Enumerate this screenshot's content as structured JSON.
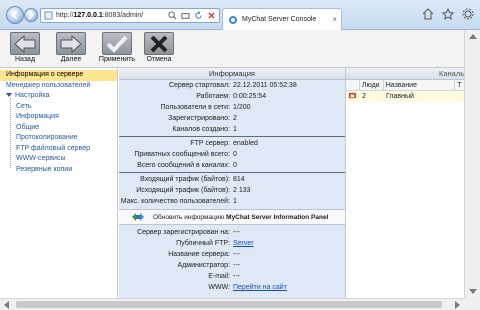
{
  "browser": {
    "address_prefix": "http://",
    "address_host": "127.0.0.1",
    "address_rest": ":8083/admin/",
    "tab_title": "MyChat Server Console",
    "tab_close": "×"
  },
  "toolbar": {
    "back": "Назад",
    "forward": "Далее",
    "apply": "Применить",
    "cancel": "Отмена"
  },
  "sidebar": {
    "items": [
      {
        "label": "Информация о сервере"
      },
      {
        "label": "Менеджер пользователей"
      },
      {
        "label": "Настройка"
      },
      {
        "label": "Сеть"
      },
      {
        "label": "Информация"
      },
      {
        "label": "Общие"
      },
      {
        "label": "Протоколирование"
      },
      {
        "label": "FTP файловый сервер"
      },
      {
        "label": "WWW-сервисы"
      },
      {
        "label": "Резервные копии"
      }
    ]
  },
  "info": {
    "header": "Информация",
    "rows_a": [
      {
        "k": "Сервер стартовал:",
        "v": "22.12.2011 05:52:38"
      },
      {
        "k": "Работаем:",
        "v": "0:00:25:54"
      },
      {
        "k": "Пользователи в сети:",
        "v": "1/200"
      },
      {
        "k": "Зарегистрировано:",
        "v": "2"
      },
      {
        "k": "Каналов создано:",
        "v": "1"
      }
    ],
    "rows_b": [
      {
        "k": "FTP сервер:",
        "v": "enabled"
      },
      {
        "k": "Приватных сообщений всего:",
        "v": "0"
      },
      {
        "k": "Всего сообщений в каналах:",
        "v": "0"
      }
    ],
    "rows_c": [
      {
        "k": "Входящий трафик (байтов):",
        "v": "814"
      },
      {
        "k": "Исходящий трафик (байтов):",
        "v": "2 133"
      },
      {
        "k": "Макс. количество пользователей:",
        "v": "1"
      }
    ],
    "update_prefix": "Обновить информацию ",
    "update_bold": "MyChat Server Information Panel",
    "rows_d": [
      {
        "k": "Сервер зарегистрирован на:",
        "v": "---"
      },
      {
        "k": "Публичный FTP:",
        "v": "Server"
      },
      {
        "k": "Название сервера:",
        "v": "---"
      },
      {
        "k": "Администратор:",
        "v": "---"
      },
      {
        "k": "E-mail:",
        "v": "---"
      },
      {
        "k": "WWW:",
        "v": "Перейти на сайт"
      }
    ]
  },
  "channels": {
    "header": "Каналы",
    "columns": [
      "Люди",
      "Название",
      "Т"
    ],
    "rows": [
      {
        "people": "2",
        "name": "Главный"
      }
    ]
  }
}
